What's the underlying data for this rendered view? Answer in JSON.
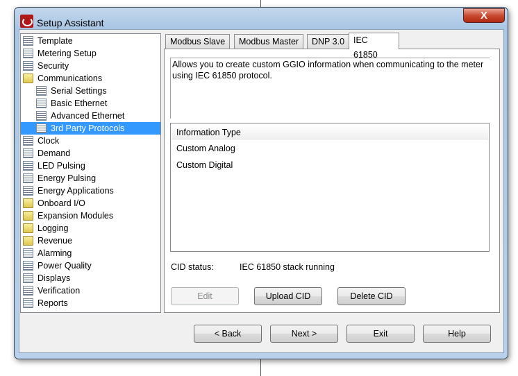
{
  "window": {
    "title": "Setup Assistant",
    "close_label": "X"
  },
  "tree": [
    {
      "label": "Template",
      "icon": "doc",
      "level": 0
    },
    {
      "label": "Metering Setup",
      "icon": "doc",
      "level": 0
    },
    {
      "label": "Security",
      "icon": "doc",
      "level": 0
    },
    {
      "label": "Communications",
      "icon": "folder",
      "level": 0
    },
    {
      "label": "Serial Settings",
      "icon": "doc",
      "level": 1
    },
    {
      "label": "Basic Ethernet",
      "icon": "doc",
      "level": 1
    },
    {
      "label": "Advanced Ethernet",
      "icon": "doc",
      "level": 1
    },
    {
      "label": "3rd Party Protocols",
      "icon": "doc",
      "level": 1,
      "selected": true
    },
    {
      "label": "Clock",
      "icon": "doc",
      "level": 0
    },
    {
      "label": "Demand",
      "icon": "doc",
      "level": 0
    },
    {
      "label": "LED Pulsing",
      "icon": "doc",
      "level": 0
    },
    {
      "label": "Energy Pulsing",
      "icon": "doc",
      "level": 0
    },
    {
      "label": "Energy Applications",
      "icon": "doc",
      "level": 0
    },
    {
      "label": "Onboard I/O",
      "icon": "folder",
      "level": 0
    },
    {
      "label": "Expansion Modules",
      "icon": "folder",
      "level": 0
    },
    {
      "label": "Logging",
      "icon": "folder",
      "level": 0
    },
    {
      "label": "Revenue",
      "icon": "folder",
      "level": 0
    },
    {
      "label": "Alarming",
      "icon": "doc",
      "level": 0
    },
    {
      "label": "Power Quality",
      "icon": "doc",
      "level": 0
    },
    {
      "label": "Displays",
      "icon": "doc",
      "level": 0
    },
    {
      "label": "Verification",
      "icon": "doc",
      "level": 0
    },
    {
      "label": "Reports",
      "icon": "doc",
      "level": 0
    }
  ],
  "tabs": [
    {
      "label": "Modbus Slave"
    },
    {
      "label": "Modbus Master"
    },
    {
      "label": "DNP 3.0"
    },
    {
      "label": "IEC 61850",
      "active": true
    }
  ],
  "main": {
    "description": "Allows you to create custom GGIO information when communicating to the meter using IEC 61850 protocol.",
    "list_header": "Information Type",
    "list_items": [
      "Custom Analog",
      "Custom Digital"
    ],
    "cid_status_label": "CID status:",
    "cid_status_value": "IEC 61850 stack running",
    "edit_label": "Edit",
    "upload_label": "Upload CID",
    "delete_label": "Delete CID"
  },
  "footer": {
    "back": "< Back",
    "next": "Next >",
    "exit": "Exit",
    "help": "Help"
  },
  "colors": {
    "selection": "#3399ff",
    "close": "#c84a30"
  }
}
